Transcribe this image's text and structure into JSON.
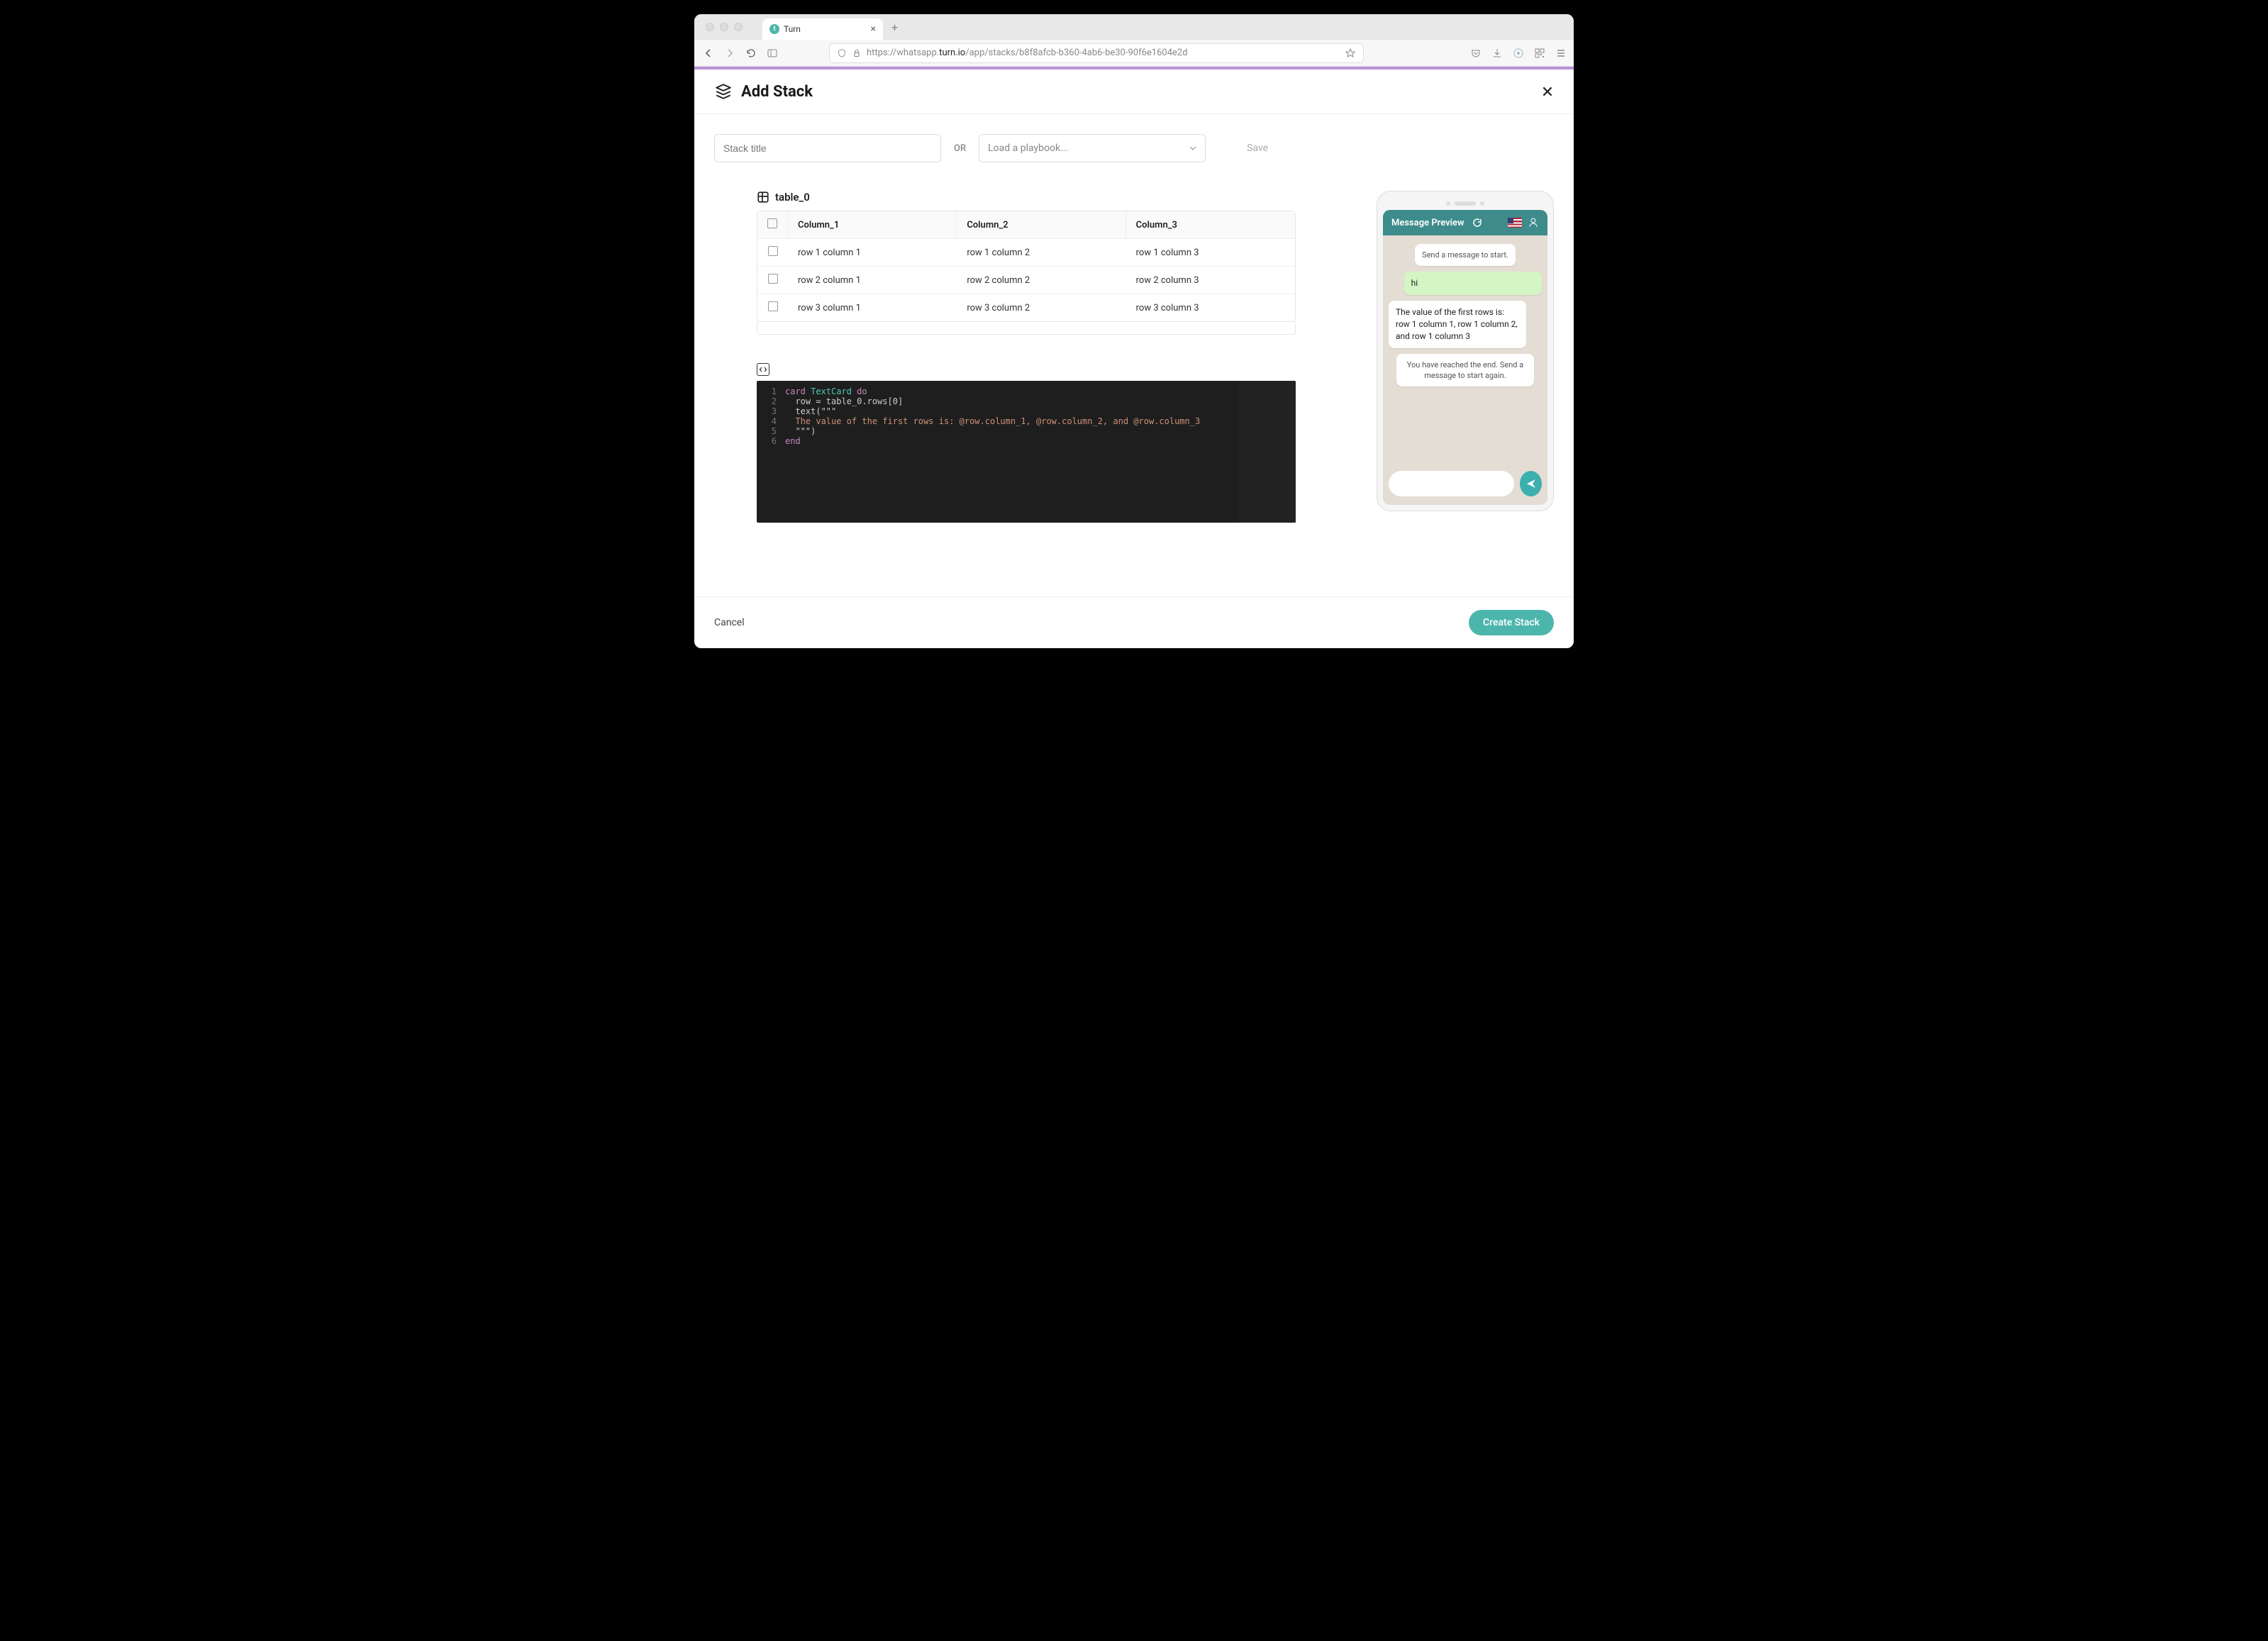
{
  "browser": {
    "tab_title": "Turn",
    "url_prefix": "https://whatsapp.",
    "url_domain": "turn.io",
    "url_path": "/app/stacks/b8f8afcb-b360-4ab6-be30-90f6e1604e2d"
  },
  "header": {
    "title": "Add Stack"
  },
  "controls": {
    "title_placeholder": "Stack title",
    "or_label": "OR",
    "playbook_placeholder": "Load a playbook...",
    "save_label": "Save"
  },
  "table": {
    "name": "table_0",
    "columns": [
      "Column_1",
      "Column_2",
      "Column_3"
    ],
    "rows": [
      [
        "row 1 column 1",
        "row 1 column 2",
        "row 1 column 3"
      ],
      [
        "row 2 column 1",
        "row 2 column 2",
        "row 2 column 3"
      ],
      [
        "row 3 column 1",
        "row 3 column 2",
        "row 3 column 3"
      ]
    ]
  },
  "code": {
    "lines": [
      {
        "n": "1",
        "t": "card TextCard do"
      },
      {
        "n": "2",
        "t": "  row = table_0.rows[0]"
      },
      {
        "n": "3",
        "t": "  text(\"\"\""
      },
      {
        "n": "4",
        "t": "  The value of the first rows is: @row.column_1, @row.column_2, and @row.column_3"
      },
      {
        "n": "5",
        "t": "  \"\"\")"
      },
      {
        "n": "6",
        "t": "end"
      }
    ]
  },
  "preview": {
    "header_title": "Message Preview",
    "messages": {
      "start": "Send a message to start.",
      "user_hi": "hi",
      "bot_reply": "The value of the first rows is: row 1 column 1, row 1 column 2, and row 1 column 3",
      "end": "You have reached the end. Send a message to start again."
    }
  },
  "footer": {
    "cancel": "Cancel",
    "create": "Create Stack"
  }
}
